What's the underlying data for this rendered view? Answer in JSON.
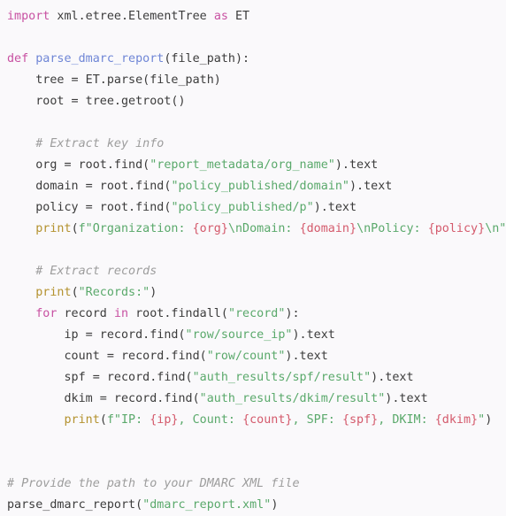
{
  "editor": {
    "language": "python",
    "background_color": "#faf9fb",
    "default_text_color": "#3c3c3c"
  },
  "theme": {
    "keyword_color": "#c851a2",
    "function_name_color": "#6f86d6",
    "builtin_color": "#b4922f",
    "string_color": "#5aa96b",
    "placeholder_color": "#d45a6c",
    "comment_color": "#9d9d9d"
  },
  "code": {
    "lines": [
      {
        "id": "line-1",
        "tokens": [
          {
            "t": "import",
            "c": "t-kw"
          },
          {
            "t": " xml.etree.ElementTree ",
            "c": "t-txt"
          },
          {
            "t": "as",
            "c": "t-kw"
          },
          {
            "t": " ET",
            "c": "t-txt"
          }
        ]
      },
      {
        "id": "line-2",
        "tokens": []
      },
      {
        "id": "line-3",
        "tokens": [
          {
            "t": "def",
            "c": "t-kw"
          },
          {
            "t": " ",
            "c": "t-txt"
          },
          {
            "t": "parse_dmarc_report",
            "c": "t-fn"
          },
          {
            "t": "(file_path):",
            "c": "t-txt"
          }
        ]
      },
      {
        "id": "line-4",
        "tokens": [
          {
            "t": "    tree = ET.parse(file_path)",
            "c": "t-txt"
          }
        ]
      },
      {
        "id": "line-5",
        "tokens": [
          {
            "t": "    root = tree.getroot()",
            "c": "t-txt"
          }
        ]
      },
      {
        "id": "line-6",
        "tokens": []
      },
      {
        "id": "line-7",
        "tokens": [
          {
            "t": "    ",
            "c": "t-txt"
          },
          {
            "t": "# Extract key info",
            "c": "t-cm"
          }
        ]
      },
      {
        "id": "line-8",
        "tokens": [
          {
            "t": "    org = root.find(",
            "c": "t-txt"
          },
          {
            "t": "\"report_metadata/org_name\"",
            "c": "t-str"
          },
          {
            "t": ").text",
            "c": "t-txt"
          }
        ]
      },
      {
        "id": "line-9",
        "tokens": [
          {
            "t": "    domain = root.find(",
            "c": "t-txt"
          },
          {
            "t": "\"policy_published/domain\"",
            "c": "t-str"
          },
          {
            "t": ").text",
            "c": "t-txt"
          }
        ]
      },
      {
        "id": "line-10",
        "tokens": [
          {
            "t": "    policy = root.find(",
            "c": "t-txt"
          },
          {
            "t": "\"policy_published/p\"",
            "c": "t-str"
          },
          {
            "t": ").text",
            "c": "t-txt"
          }
        ]
      },
      {
        "id": "line-11",
        "tokens": [
          {
            "t": "    ",
            "c": "t-txt"
          },
          {
            "t": "print",
            "c": "t-bi"
          },
          {
            "t": "(",
            "c": "t-txt"
          },
          {
            "t": "f\"Organization: ",
            "c": "t-str"
          },
          {
            "t": "{org}",
            "c": "t-ph"
          },
          {
            "t": "\\nDomain: ",
            "c": "t-str"
          },
          {
            "t": "{domain}",
            "c": "t-ph"
          },
          {
            "t": "\\nPolicy: ",
            "c": "t-str"
          },
          {
            "t": "{policy}",
            "c": "t-ph"
          },
          {
            "t": "\\n\"",
            "c": "t-str"
          },
          {
            "t": ")",
            "c": "t-txt"
          }
        ]
      },
      {
        "id": "line-12",
        "tokens": []
      },
      {
        "id": "line-13",
        "tokens": [
          {
            "t": "    ",
            "c": "t-txt"
          },
          {
            "t": "# Extract records",
            "c": "t-cm"
          }
        ]
      },
      {
        "id": "line-14",
        "tokens": [
          {
            "t": "    ",
            "c": "t-txt"
          },
          {
            "t": "print",
            "c": "t-bi"
          },
          {
            "t": "(",
            "c": "t-txt"
          },
          {
            "t": "\"Records:\"",
            "c": "t-str"
          },
          {
            "t": ")",
            "c": "t-txt"
          }
        ]
      },
      {
        "id": "line-15",
        "tokens": [
          {
            "t": "    ",
            "c": "t-txt"
          },
          {
            "t": "for",
            "c": "t-kw"
          },
          {
            "t": " record ",
            "c": "t-txt"
          },
          {
            "t": "in",
            "c": "t-kw"
          },
          {
            "t": " root.findall(",
            "c": "t-txt"
          },
          {
            "t": "\"record\"",
            "c": "t-str"
          },
          {
            "t": "):",
            "c": "t-txt"
          }
        ]
      },
      {
        "id": "line-16",
        "tokens": [
          {
            "t": "        ip = record.find(",
            "c": "t-txt"
          },
          {
            "t": "\"row/source_ip\"",
            "c": "t-str"
          },
          {
            "t": ").text",
            "c": "t-txt"
          }
        ]
      },
      {
        "id": "line-17",
        "tokens": [
          {
            "t": "        count = record.find(",
            "c": "t-txt"
          },
          {
            "t": "\"row/count\"",
            "c": "t-str"
          },
          {
            "t": ").text",
            "c": "t-txt"
          }
        ]
      },
      {
        "id": "line-18",
        "tokens": [
          {
            "t": "        spf = record.find(",
            "c": "t-txt"
          },
          {
            "t": "\"auth_results/spf/result\"",
            "c": "t-str"
          },
          {
            "t": ").text",
            "c": "t-txt"
          }
        ]
      },
      {
        "id": "line-19",
        "tokens": [
          {
            "t": "        dkim = record.find(",
            "c": "t-txt"
          },
          {
            "t": "\"auth_results/dkim/result\"",
            "c": "t-str"
          },
          {
            "t": ").text",
            "c": "t-txt"
          }
        ]
      },
      {
        "id": "line-20",
        "tokens": [
          {
            "t": "        ",
            "c": "t-txt"
          },
          {
            "t": "print",
            "c": "t-bi"
          },
          {
            "t": "(",
            "c": "t-txt"
          },
          {
            "t": "f\"IP: ",
            "c": "t-str"
          },
          {
            "t": "{ip}",
            "c": "t-ph"
          },
          {
            "t": ", Count: ",
            "c": "t-str"
          },
          {
            "t": "{count}",
            "c": "t-ph"
          },
          {
            "t": ", SPF: ",
            "c": "t-str"
          },
          {
            "t": "{spf}",
            "c": "t-ph"
          },
          {
            "t": ", DKIM: ",
            "c": "t-str"
          },
          {
            "t": "{dkim}",
            "c": "t-ph"
          },
          {
            "t": "\"",
            "c": "t-str"
          },
          {
            "t": ")",
            "c": "t-txt"
          }
        ]
      },
      {
        "id": "line-21",
        "tokens": []
      },
      {
        "id": "line-22",
        "tokens": []
      },
      {
        "id": "line-23",
        "tokens": [
          {
            "t": "# Provide the path to your DMARC XML file",
            "c": "t-cm"
          }
        ]
      },
      {
        "id": "line-24",
        "tokens": [
          {
            "t": "parse_dmarc_report(",
            "c": "t-txt"
          },
          {
            "t": "\"dmarc_report.xml\"",
            "c": "t-str"
          },
          {
            "t": ")",
            "c": "t-txt"
          }
        ]
      }
    ]
  }
}
